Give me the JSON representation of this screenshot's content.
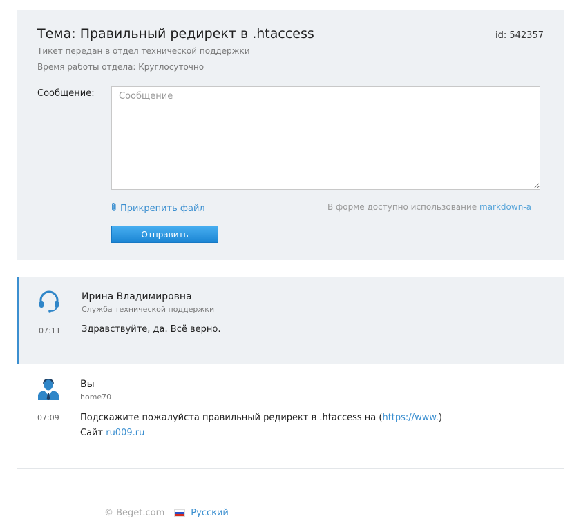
{
  "ticket": {
    "title": "Тема: Правильный редирект в .htaccess",
    "id_label": "id: 542357",
    "meta_line1": "Тикет передан в отдел технической поддержки",
    "meta_line2": "Время работы отдела: Круглосуточно",
    "message_label": "Сообщение:",
    "message_placeholder": "Сообщение",
    "message_value": "",
    "attach_label": "Прикрепить файл",
    "markdown_note_prefix": "В форме доступно использование",
    "markdown_link": "markdown-а",
    "send_label": "Отправить"
  },
  "messages": [
    {
      "author": "Ирина Владимировна",
      "role": "Служба технической поддержки",
      "time": "07:11",
      "text": "Здравствуйте, да. Всё верно.",
      "avatar_icon": "headset-icon"
    },
    {
      "author": "Вы",
      "role": "home70",
      "time": "07:09",
      "text_prefix": "Подскажите пожалуйста правильный редирект в .htaccess на (",
      "text_link": "https://www.",
      "text_suffix": ")",
      "line2_prefix": "Сайт",
      "line2_link": "ru009.ru",
      "avatar_icon": "user-tie-icon"
    }
  ],
  "footer": {
    "copyright": "© Beget.com",
    "language": "Русский",
    "flag_icon": "russia-flag-icon"
  },
  "colors": {
    "panel_bg": "#eef1f4",
    "accent": "#3b8fd0",
    "button": "#1c86d4"
  }
}
